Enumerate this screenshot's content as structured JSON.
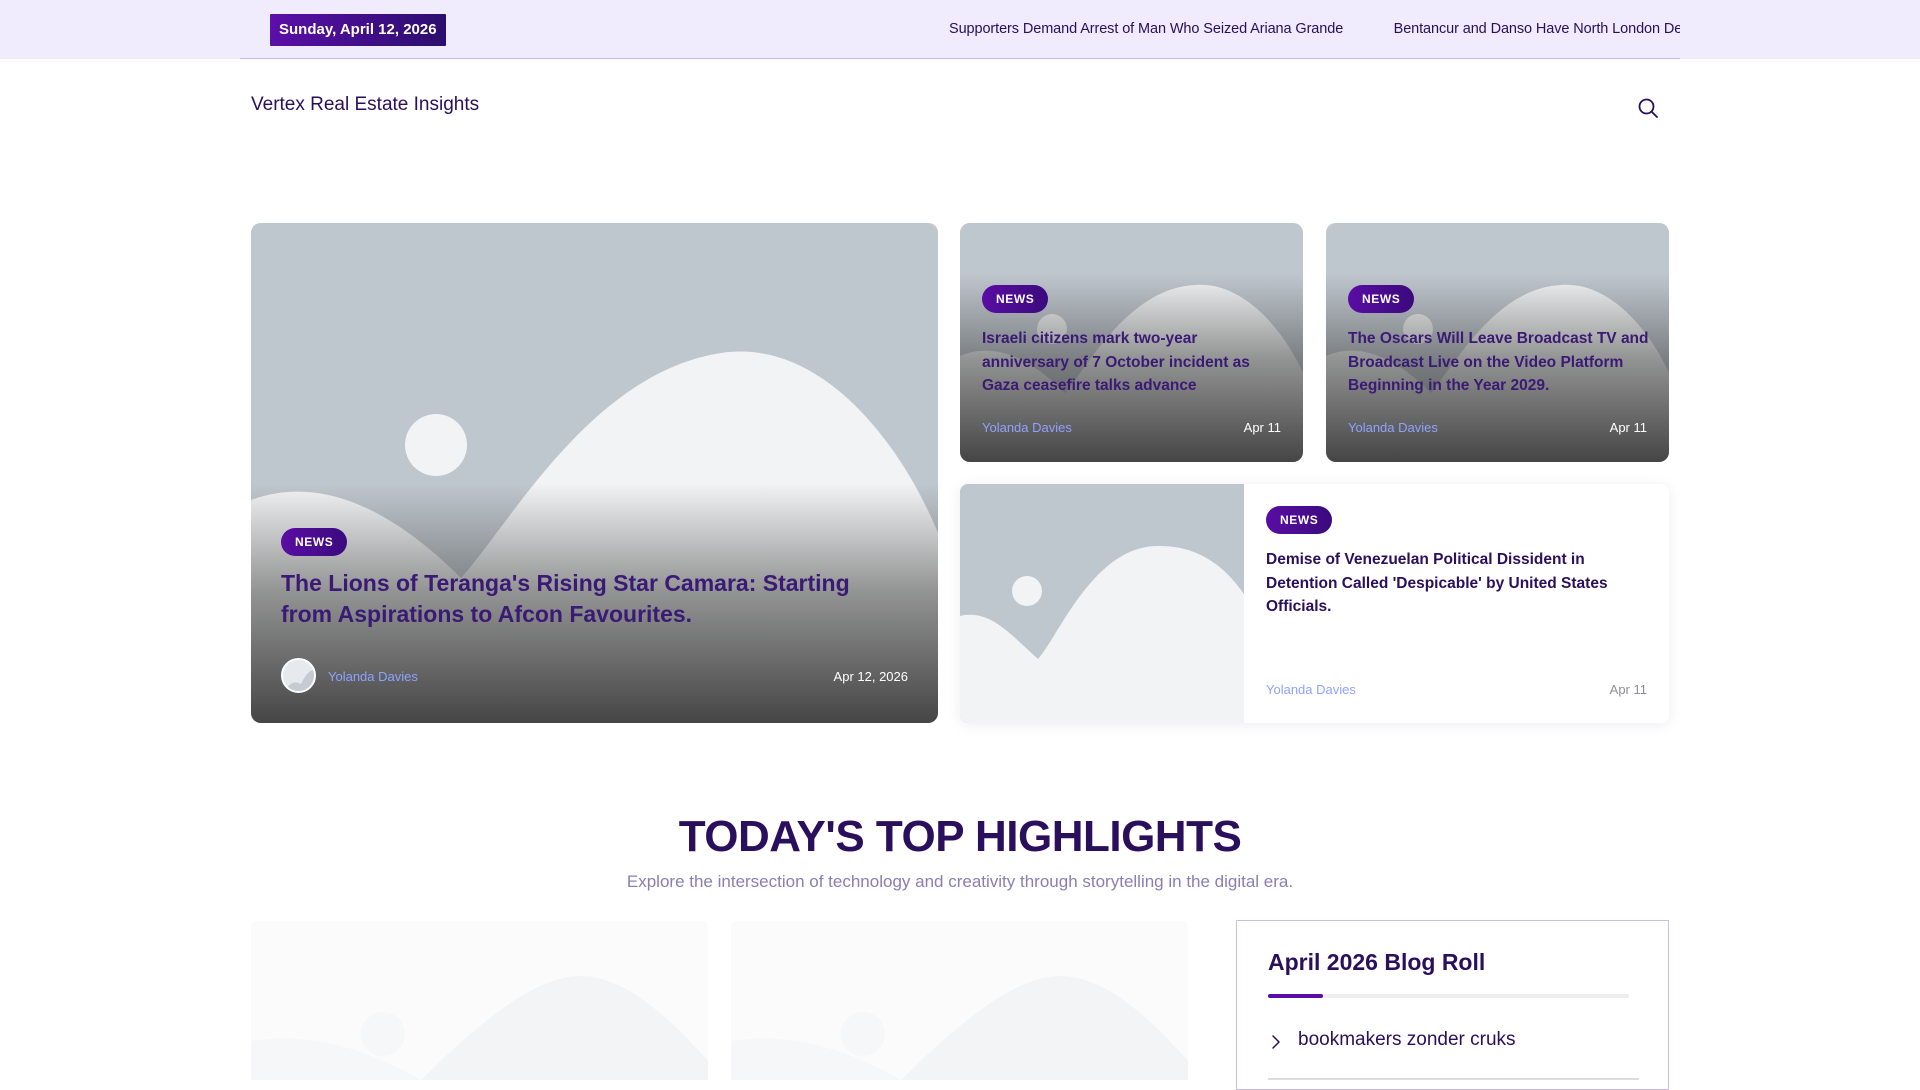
{
  "topbar": {
    "date": "Sunday, April 12, 2026",
    "ticker": [
      "Supporters Demand Arrest of Man Who Seized Ariana Grande",
      "Bentancur and Danso Have North London Derby"
    ]
  },
  "header": {
    "site_title": "Vertex Real Estate Insights"
  },
  "featured": {
    "main": {
      "tag": "NEWS",
      "title": "The Lions of Teranga's Rising Star Camara: Starting from Aspirations to Afcon Favourites.",
      "author": "Yolanda Davies",
      "date": "Apr 12, 2026"
    },
    "card2": {
      "tag": "NEWS",
      "title": "Israeli citizens mark two-year anniversary of 7 October incident as Gaza ceasefire talks advance",
      "author": "Yolanda Davies",
      "date": "Apr 11"
    },
    "card3": {
      "tag": "NEWS",
      "title": "The Oscars Will Leave Broadcast TV and Broadcast Live on the Video Platform Beginning in the Year 2029.",
      "author": "Yolanda Davies",
      "date": "Apr 11"
    },
    "card4": {
      "tag": "NEWS",
      "title": "Demise of Venezuelan Political Dissident in Detention Called 'Despicable' by United States Officials.",
      "author": "Yolanda Davies",
      "date": "Apr 11"
    }
  },
  "highlights": {
    "title": "TODAY'S TOP HIGHLIGHTS",
    "subtitle": "Explore the intersection of technology and creativity through storytelling in the digital era."
  },
  "blogroll": {
    "title": "April 2026 Blog Roll",
    "items": [
      {
        "label": "bookmakers zonder cruks"
      }
    ]
  },
  "icons": {
    "search": "search-icon",
    "chevron": "chevron-right-icon",
    "image_placeholder": "image-placeholder-icon"
  },
  "colors": {
    "brand": "#5a0da4",
    "text": "#2a0f5c",
    "topbar_bg": "#f0ebfd",
    "author": "#8fa2ff",
    "placeholder_bg": "#bfc7ce"
  }
}
